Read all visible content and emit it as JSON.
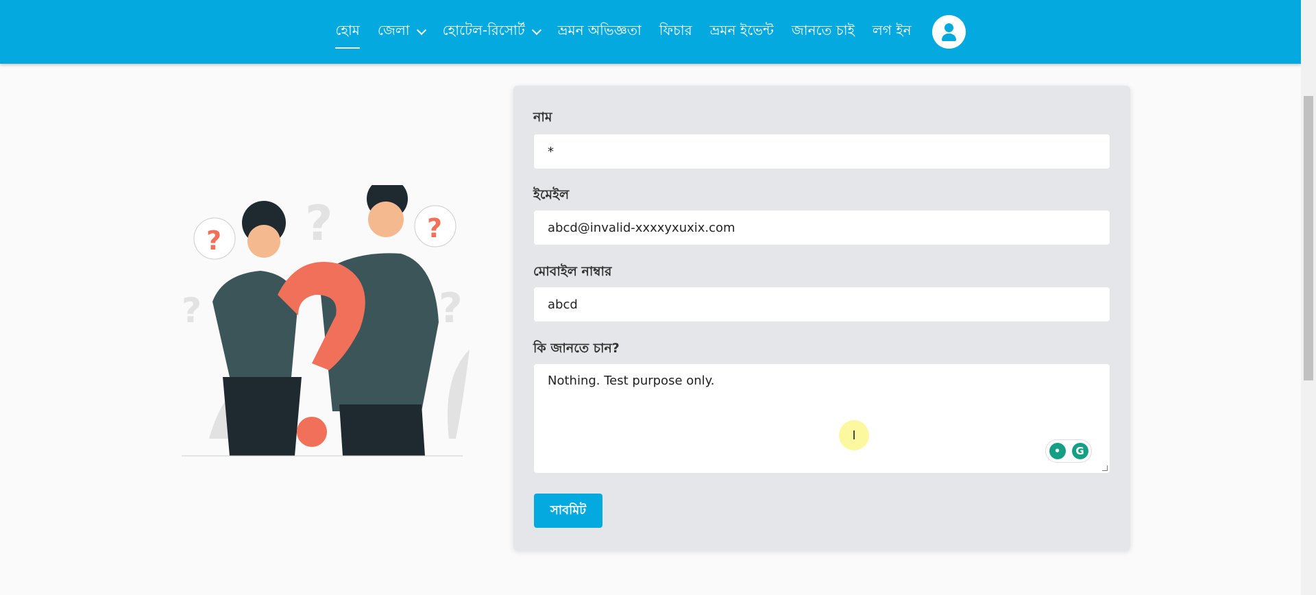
{
  "nav": {
    "items": [
      {
        "label": "হোম",
        "active": true
      },
      {
        "label": "জেলা",
        "dropdown": true
      },
      {
        "label": "হোটেল-রিসোর্ট",
        "dropdown": true
      },
      {
        "label": "ভ্রমন অভিজ্ঞতা"
      },
      {
        "label": "ফিচার"
      },
      {
        "label": "ভ্রমন ইভেন্ট"
      },
      {
        "label": "জানতে চাই"
      },
      {
        "label": "লগ ইন"
      }
    ],
    "avatar_icon": "user-icon"
  },
  "form": {
    "name_label": "নাম",
    "name_value": "*",
    "email_label": "ইমেইল",
    "email_value": "abcd@invalid-xxxxyxuxix.com",
    "mobile_label": "মোবাইল নাম্বার",
    "mobile_value": "abcd",
    "question_label": "কি জানতে চান?",
    "question_value": "Nothing. Test purpose only.",
    "submit_label": "সাবমিট",
    "grammarly_letter": "G"
  },
  "colors": {
    "primary": "#04a9df",
    "card": "#e4e6ea"
  }
}
